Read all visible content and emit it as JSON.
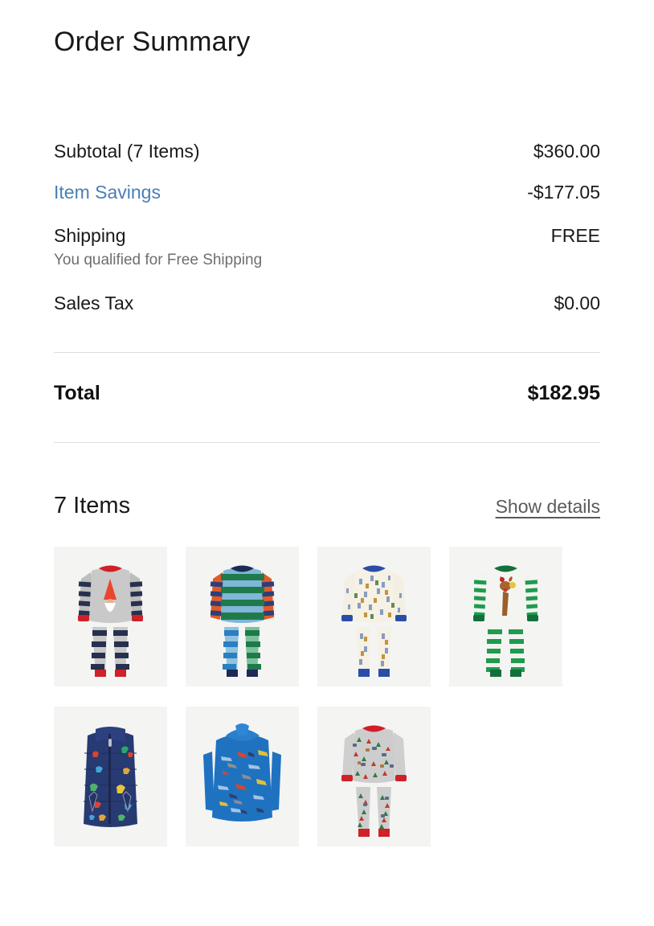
{
  "header": {
    "title": "Order Summary"
  },
  "summary": {
    "rows": [
      {
        "label": "Subtotal (7 Items)",
        "value": "$360.00"
      },
      {
        "label": "Item Savings",
        "value": "-$177.05"
      },
      {
        "label": "Shipping",
        "value": "FREE",
        "note": "You qualified for Free Shipping"
      },
      {
        "label": "Sales Tax",
        "value": "$0.00"
      }
    ],
    "total": {
      "label": "Total",
      "value": "$182.95"
    }
  },
  "items_section": {
    "count_label": "7 Items",
    "show_details_label": "Show details",
    "items": [
      {
        "name": "gnome-striped-pajamas-thumbnail",
        "alt": "Gray and navy striped gnome pajama set with red trim"
      },
      {
        "name": "multi-stripe-pajamas-thumbnail",
        "alt": "Green and blue multi-stripe pajama set with red sleeves"
      },
      {
        "name": "cream-print-pajamas-thumbnail",
        "alt": "Cream printed pajama set with blue trim"
      },
      {
        "name": "green-stripe-reindeer-pajamas-thumbnail",
        "alt": "Green and white striped reindeer pajama set"
      },
      {
        "name": "dinosaur-puffer-vest-thumbnail",
        "alt": "Navy puffer vest with colorful dinosaur print"
      },
      {
        "name": "airplane-hoodie-thumbnail",
        "alt": "Blue hoodie with airplane print"
      },
      {
        "name": "holiday-print-pajamas-thumbnail",
        "alt": "Gray holiday print pajama set with red trim"
      }
    ]
  },
  "colors": {
    "savings_accent": "#4a7fb5",
    "rule": "#dedede",
    "note_text": "#6e6e6e",
    "thumb_background": "#f4f4f3",
    "link_text": "#5a5a5a"
  }
}
